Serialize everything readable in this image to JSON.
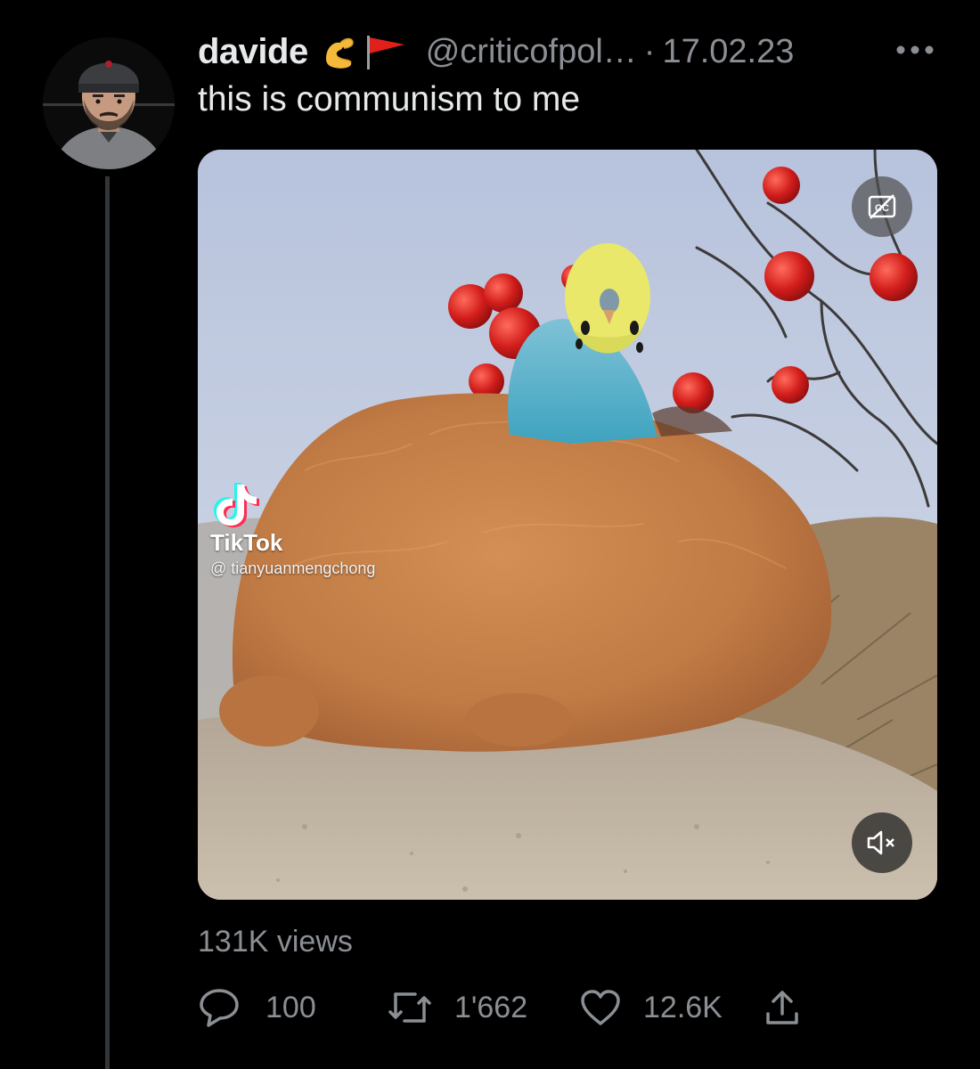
{
  "tweet": {
    "display_name": "davide",
    "name_emojis": [
      "pinching-hand-emoji",
      "red-flag-emoji"
    ],
    "handle": "@criticofpol…",
    "separator": "·",
    "date": "17.02.23",
    "text": "this is communism to me"
  },
  "media": {
    "watermark_brand": "TikTok",
    "watermark_user": "@ tianyuanmengchong"
  },
  "stats": {
    "views_label": "131K views"
  },
  "actions": {
    "replies": "100",
    "retweets": "1'662",
    "likes": "12.6K"
  },
  "colors": {
    "background": "#000000",
    "primary_text": "#e7e9ea",
    "secondary_text": "#8b8f94",
    "thread_line": "#333639"
  }
}
